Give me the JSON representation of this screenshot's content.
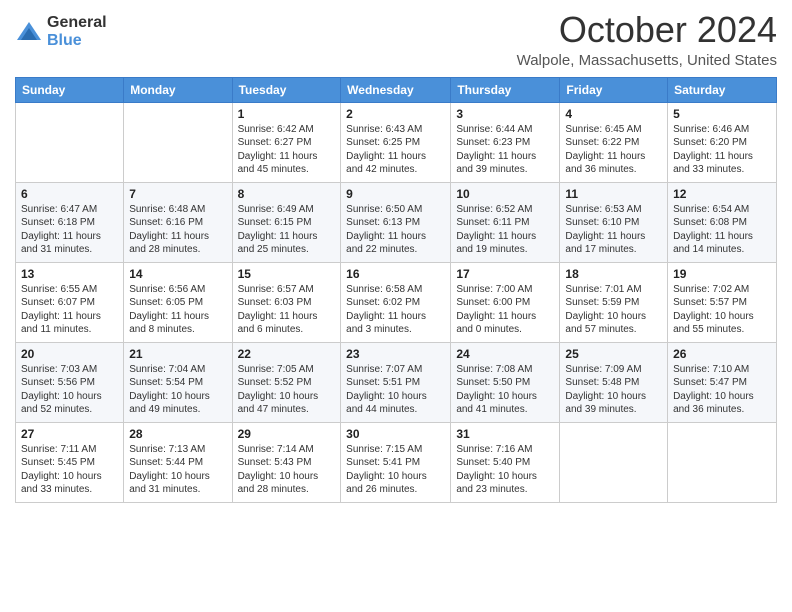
{
  "logo": {
    "general": "General",
    "blue": "Blue"
  },
  "header": {
    "month": "October 2024",
    "location": "Walpole, Massachusetts, United States"
  },
  "days_of_week": [
    "Sunday",
    "Monday",
    "Tuesday",
    "Wednesday",
    "Thursday",
    "Friday",
    "Saturday"
  ],
  "weeks": [
    [
      {
        "day": "",
        "info": ""
      },
      {
        "day": "",
        "info": ""
      },
      {
        "day": "1",
        "info": "Sunrise: 6:42 AM\nSunset: 6:27 PM\nDaylight: 11 hours and 45 minutes."
      },
      {
        "day": "2",
        "info": "Sunrise: 6:43 AM\nSunset: 6:25 PM\nDaylight: 11 hours and 42 minutes."
      },
      {
        "day": "3",
        "info": "Sunrise: 6:44 AM\nSunset: 6:23 PM\nDaylight: 11 hours and 39 minutes."
      },
      {
        "day": "4",
        "info": "Sunrise: 6:45 AM\nSunset: 6:22 PM\nDaylight: 11 hours and 36 minutes."
      },
      {
        "day": "5",
        "info": "Sunrise: 6:46 AM\nSunset: 6:20 PM\nDaylight: 11 hours and 33 minutes."
      }
    ],
    [
      {
        "day": "6",
        "info": "Sunrise: 6:47 AM\nSunset: 6:18 PM\nDaylight: 11 hours and 31 minutes."
      },
      {
        "day": "7",
        "info": "Sunrise: 6:48 AM\nSunset: 6:16 PM\nDaylight: 11 hours and 28 minutes."
      },
      {
        "day": "8",
        "info": "Sunrise: 6:49 AM\nSunset: 6:15 PM\nDaylight: 11 hours and 25 minutes."
      },
      {
        "day": "9",
        "info": "Sunrise: 6:50 AM\nSunset: 6:13 PM\nDaylight: 11 hours and 22 minutes."
      },
      {
        "day": "10",
        "info": "Sunrise: 6:52 AM\nSunset: 6:11 PM\nDaylight: 11 hours and 19 minutes."
      },
      {
        "day": "11",
        "info": "Sunrise: 6:53 AM\nSunset: 6:10 PM\nDaylight: 11 hours and 17 minutes."
      },
      {
        "day": "12",
        "info": "Sunrise: 6:54 AM\nSunset: 6:08 PM\nDaylight: 11 hours and 14 minutes."
      }
    ],
    [
      {
        "day": "13",
        "info": "Sunrise: 6:55 AM\nSunset: 6:07 PM\nDaylight: 11 hours and 11 minutes."
      },
      {
        "day": "14",
        "info": "Sunrise: 6:56 AM\nSunset: 6:05 PM\nDaylight: 11 hours and 8 minutes."
      },
      {
        "day": "15",
        "info": "Sunrise: 6:57 AM\nSunset: 6:03 PM\nDaylight: 11 hours and 6 minutes."
      },
      {
        "day": "16",
        "info": "Sunrise: 6:58 AM\nSunset: 6:02 PM\nDaylight: 11 hours and 3 minutes."
      },
      {
        "day": "17",
        "info": "Sunrise: 7:00 AM\nSunset: 6:00 PM\nDaylight: 11 hours and 0 minutes."
      },
      {
        "day": "18",
        "info": "Sunrise: 7:01 AM\nSunset: 5:59 PM\nDaylight: 10 hours and 57 minutes."
      },
      {
        "day": "19",
        "info": "Sunrise: 7:02 AM\nSunset: 5:57 PM\nDaylight: 10 hours and 55 minutes."
      }
    ],
    [
      {
        "day": "20",
        "info": "Sunrise: 7:03 AM\nSunset: 5:56 PM\nDaylight: 10 hours and 52 minutes."
      },
      {
        "day": "21",
        "info": "Sunrise: 7:04 AM\nSunset: 5:54 PM\nDaylight: 10 hours and 49 minutes."
      },
      {
        "day": "22",
        "info": "Sunrise: 7:05 AM\nSunset: 5:52 PM\nDaylight: 10 hours and 47 minutes."
      },
      {
        "day": "23",
        "info": "Sunrise: 7:07 AM\nSunset: 5:51 PM\nDaylight: 10 hours and 44 minutes."
      },
      {
        "day": "24",
        "info": "Sunrise: 7:08 AM\nSunset: 5:50 PM\nDaylight: 10 hours and 41 minutes."
      },
      {
        "day": "25",
        "info": "Sunrise: 7:09 AM\nSunset: 5:48 PM\nDaylight: 10 hours and 39 minutes."
      },
      {
        "day": "26",
        "info": "Sunrise: 7:10 AM\nSunset: 5:47 PM\nDaylight: 10 hours and 36 minutes."
      }
    ],
    [
      {
        "day": "27",
        "info": "Sunrise: 7:11 AM\nSunset: 5:45 PM\nDaylight: 10 hours and 33 minutes."
      },
      {
        "day": "28",
        "info": "Sunrise: 7:13 AM\nSunset: 5:44 PM\nDaylight: 10 hours and 31 minutes."
      },
      {
        "day": "29",
        "info": "Sunrise: 7:14 AM\nSunset: 5:43 PM\nDaylight: 10 hours and 28 minutes."
      },
      {
        "day": "30",
        "info": "Sunrise: 7:15 AM\nSunset: 5:41 PM\nDaylight: 10 hours and 26 minutes."
      },
      {
        "day": "31",
        "info": "Sunrise: 7:16 AM\nSunset: 5:40 PM\nDaylight: 10 hours and 23 minutes."
      },
      {
        "day": "",
        "info": ""
      },
      {
        "day": "",
        "info": ""
      }
    ]
  ]
}
